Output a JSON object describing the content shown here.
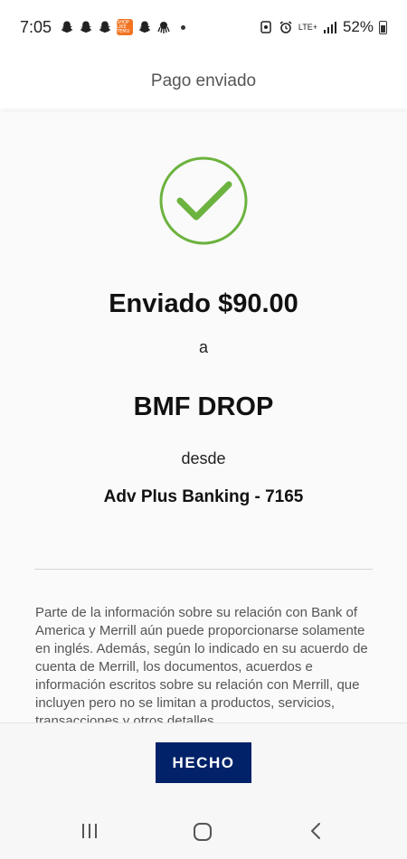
{
  "status_bar": {
    "time": "7:05",
    "network": "LTE+",
    "battery": "52%",
    "notification_icons": [
      "snapchat-icon",
      "snapchat-icon",
      "snapchat-icon",
      "temu-icon",
      "snapchat-icon",
      "octopus-icon"
    ],
    "temu_label": "SHOP LIKE TEMU"
  },
  "header": {
    "title": "Pago enviado"
  },
  "confirmation": {
    "success_color": "#6cb33f",
    "sent_label": "Enviado $90.00",
    "to_label": "a",
    "payee": "BMF DROP",
    "from_label": "desde",
    "account": "Adv Plus Banking - 7165"
  },
  "disclaimer": {
    "text": "Parte de la información sobre su relación con Bank of America y Merrill aún puede proporcionarse solamente en inglés. Además, según lo indicado en su acuerdo de cuenta de Merrill, los documentos, acuerdos e información escritos sobre su relación con Merrill, que incluyen pero no se limitan a productos, servicios, transacciones y otros detalles"
  },
  "footer": {
    "done_label": "HECHO",
    "button_color": "#012169"
  }
}
